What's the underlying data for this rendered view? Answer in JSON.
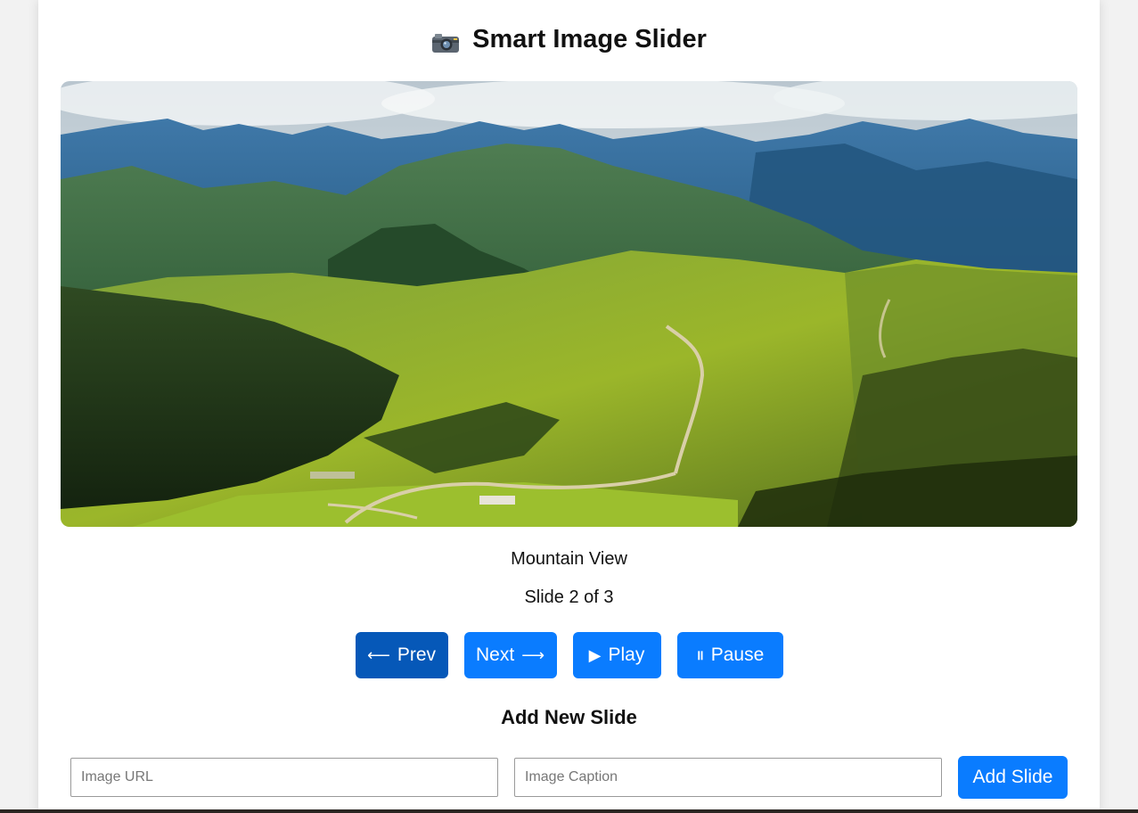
{
  "header": {
    "title": "Smart Image Slider",
    "icon": "camera-icon"
  },
  "slider": {
    "caption": "Mountain View",
    "counter": "Slide 2 of 3",
    "current": 2,
    "total": 3
  },
  "controls": {
    "prev_label": "Prev",
    "next_label": "Next",
    "play_label": "Play",
    "pause_label": "Pause",
    "prev_icon": "arrow-left-icon",
    "next_icon": "arrow-right-icon",
    "play_icon": "play-icon",
    "pause_icon": "pause-icon"
  },
  "add_slide": {
    "title": "Add New Slide",
    "url_placeholder": "Image URL",
    "url_value": "",
    "caption_placeholder": "Image Caption",
    "caption_value": "",
    "button_label": "Add Slide"
  },
  "colors": {
    "accent": "#0a7cff",
    "accent_active": "#0658b8",
    "background": "#f2f2f2",
    "card": "#ffffff"
  }
}
